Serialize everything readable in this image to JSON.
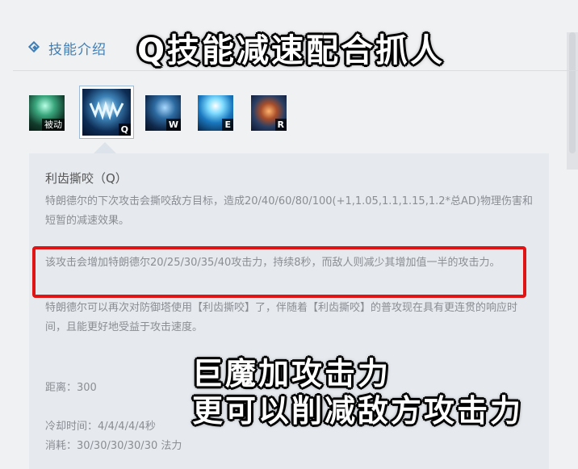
{
  "section": {
    "title": "技能介绍"
  },
  "skills": [
    {
      "key": "被动"
    },
    {
      "key": "Q"
    },
    {
      "key": "W"
    },
    {
      "key": "E"
    },
    {
      "key": "R"
    }
  ],
  "detail": {
    "name": "利齿撕咬（Q）",
    "desc1": "特朗德尔的下次攻击会撕咬敌方目标，造成20/40/60/80/100(+1,1.05,1.1,1.15,1.2*总AD)物理伤害和短暂的减速效果。",
    "desc2": "该攻击会增加特朗德尔20/25/30/35/40攻击力，持续8秒，而敌人则减少其增加值一半的攻击力。",
    "desc3": "特朗德尔可以再次对防御塔使用【利齿撕咬】了，伴随着【利齿撕咬】的普攻现在具有更连贯的响应时间，且能更好地受益于攻击速度。",
    "range": "距离：300",
    "cooldown": "冷却时间：4/4/4/4/4秒",
    "cost": "消耗：30/30/30/30/30 法力"
  },
  "overlay": {
    "top": "Q技能减速配合抓人",
    "bottom_line1": "巨魔加攻击力",
    "bottom_line2": "更可以削减敌方攻击力"
  },
  "colors": {
    "accent": "#3f7fb6",
    "highlight": "#e01414",
    "panel": "#e6eaef"
  }
}
